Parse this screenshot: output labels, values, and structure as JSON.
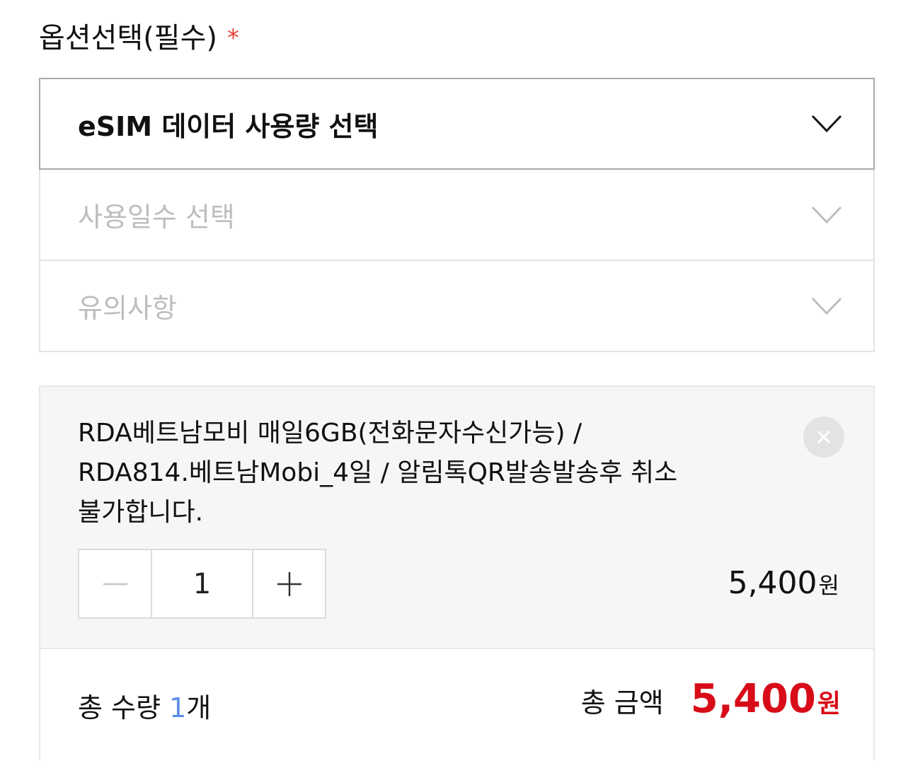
{
  "options": {
    "title": "옵션선택(필수)",
    "required_mark": "*",
    "selects": [
      {
        "label": "eSIM 데이터 사용량 선택",
        "state": "active"
      },
      {
        "label": "사용일수 선택",
        "state": "disabled"
      },
      {
        "label": "유의사항",
        "state": "disabled"
      }
    ]
  },
  "selected_item": {
    "name_line1": "RDA베트남모비 매일6GB(전화문자수신가능) /",
    "name_line2": "RDA814.베트남Mobi_4일 / 알림톡QR발송발송후 취소",
    "name_line3": "불가합니다.",
    "quantity": "1",
    "price": "5,400",
    "price_unit": "원",
    "remove_icon": "close-icon",
    "decrement_icon": "minus-icon",
    "increment_icon": "plus-icon"
  },
  "totals": {
    "qty_label": "총 수량",
    "qty_value": "1",
    "qty_unit": "개",
    "amount_label": "총 금액",
    "amount_value": "5,400",
    "amount_unit": "원"
  },
  "colors": {
    "required": "#e5413a",
    "total_price": "#d80c18",
    "count_accent": "#5b8de6"
  }
}
